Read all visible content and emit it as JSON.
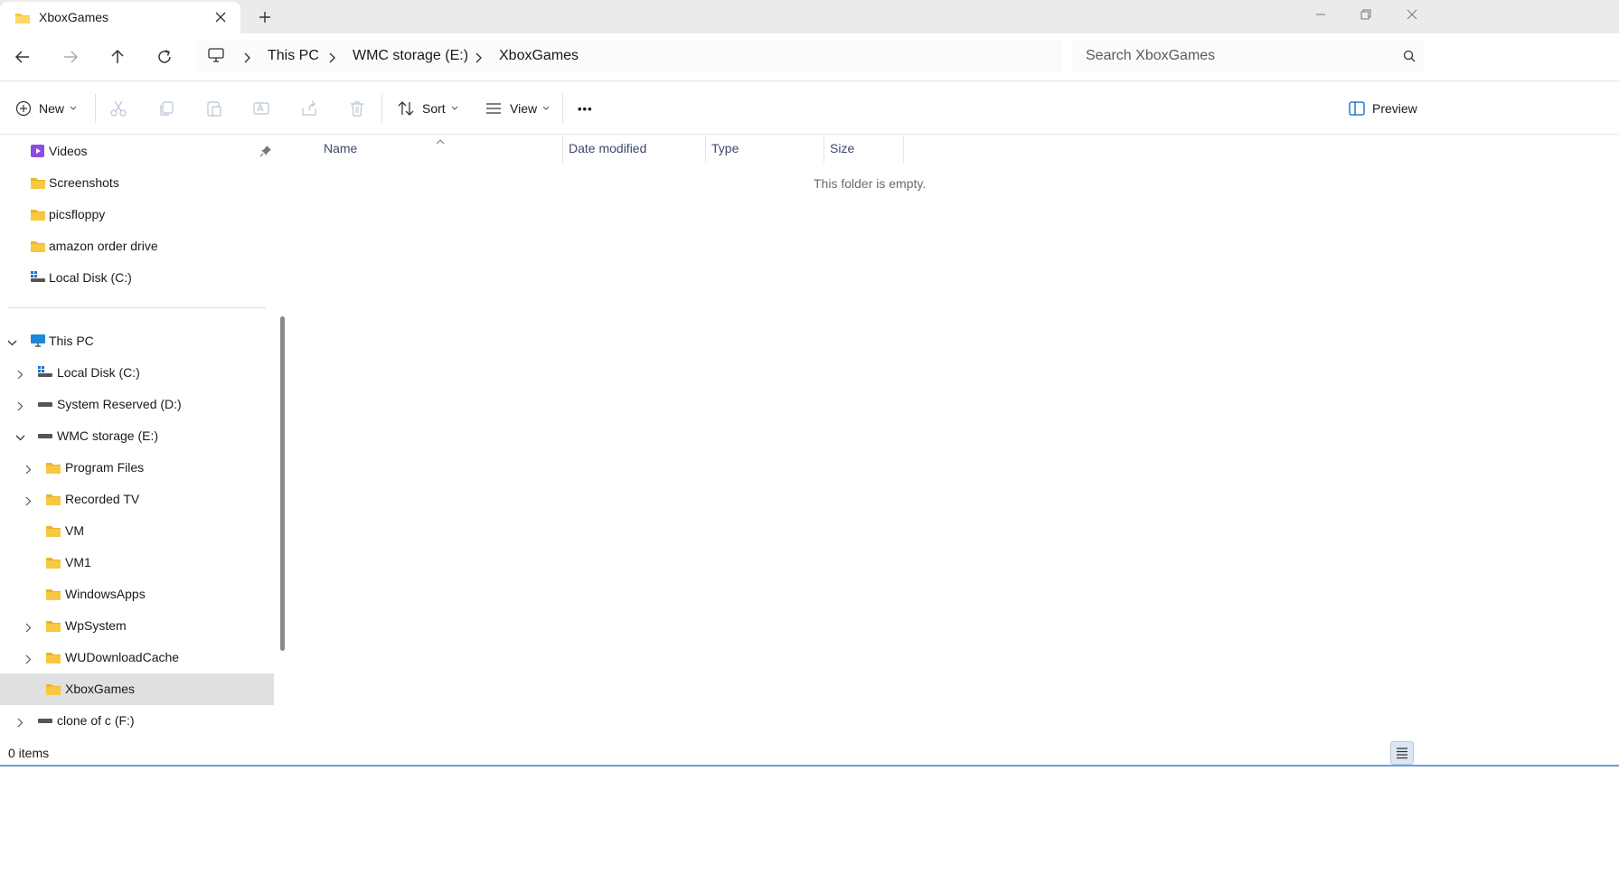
{
  "window": {
    "tab_title": "XboxGames",
    "new_tab_symbol": "+"
  },
  "address": {
    "breadcrumb": [
      "This PC",
      "WMC storage (E:)",
      "XboxGames"
    ],
    "search_placeholder": "Search XboxGames"
  },
  "commands": {
    "new_label": "New",
    "sort_label": "Sort",
    "view_label": "View",
    "more_label": "•••",
    "preview_label": "Preview"
  },
  "nav": {
    "quick_access": [
      {
        "label": "Videos",
        "icon": "videos-folder-icon",
        "pinned": true
      },
      {
        "label": "Screenshots",
        "icon": "folder-icon"
      },
      {
        "label": "picsfloppy",
        "icon": "folder-icon"
      },
      {
        "label": "amazon order drive",
        "icon": "folder-icon"
      },
      {
        "label": "Local Disk (C:)",
        "icon": "windows-drive-icon"
      }
    ],
    "this_pc": {
      "label": "This PC",
      "children": [
        {
          "label": "Local Disk (C:)"
        },
        {
          "label": "System Reserved (D:)"
        },
        {
          "label": "WMC storage (E:)"
        },
        {
          "label": "Program Files"
        },
        {
          "label": "Recorded TV"
        },
        {
          "label": "VM"
        },
        {
          "label": "VM1"
        },
        {
          "label": "WindowsApps"
        },
        {
          "label": "WpSystem"
        },
        {
          "label": "WUDownloadCache"
        },
        {
          "label": "XboxGames"
        },
        {
          "label": "clone of c (F:)"
        }
      ]
    }
  },
  "content": {
    "columns": [
      "Name",
      "Date modified",
      "Type",
      "Size"
    ],
    "sorted_by": "Name",
    "empty_message": "This folder is empty."
  },
  "status": {
    "items_text": "0 items"
  },
  "colors": {
    "folder": "#f8c842",
    "accent": "#0067c0",
    "selected_bg": "#e0e0e0",
    "header_text": "#3c4a6b"
  }
}
